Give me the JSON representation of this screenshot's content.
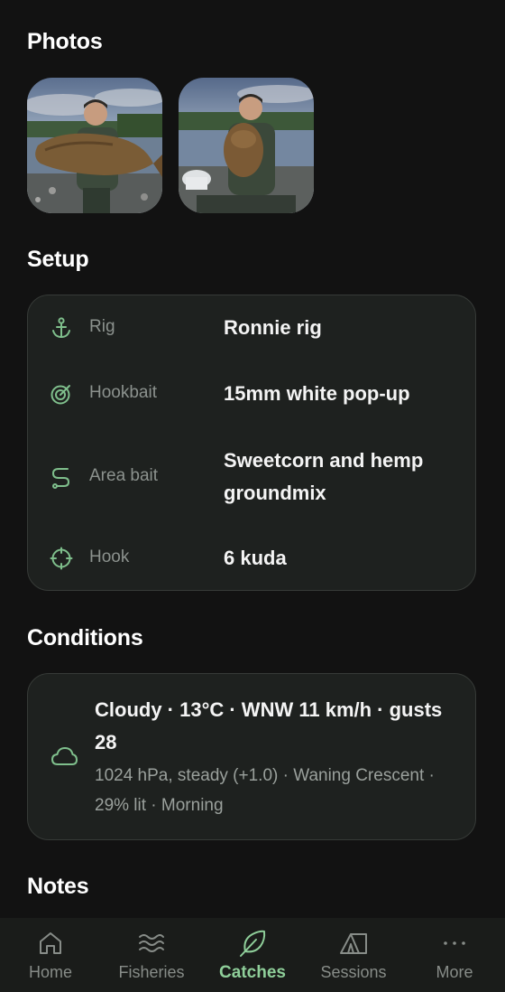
{
  "sections": {
    "photos": "Photos",
    "setup": "Setup",
    "conditions": "Conditions",
    "notes": "Notes"
  },
  "photos": [
    {
      "icon": "photo-angler-holding-carp"
    },
    {
      "icon": "photo-angler-holding-carp-front"
    }
  ],
  "setup": {
    "rows": [
      {
        "icon": "anchor-icon",
        "label": "Rig",
        "value": "Ronnie rig"
      },
      {
        "icon": "target-icon",
        "label": "Hookbait",
        "value": "15mm white pop-up"
      },
      {
        "icon": "route-icon",
        "label": "Area bait",
        "value": "Sweetcorn and hemp groundmix"
      },
      {
        "icon": "crosshair-icon",
        "label": "Hook",
        "value": "6 kuda"
      }
    ]
  },
  "conditions": {
    "icon": "cloud-icon",
    "summary": "Cloudy · 13°C · WNW 11 km/h · gusts 28",
    "details": "1024 hPa, steady (+1.0) · Waning Crescent · 29% lit · Morning"
  },
  "nav": {
    "items": [
      {
        "icon": "home-icon",
        "label": "Home",
        "active": false
      },
      {
        "icon": "waves-icon",
        "label": "Fisheries",
        "active": false
      },
      {
        "icon": "leaf-icon",
        "label": "Catches",
        "active": true
      },
      {
        "icon": "tent-icon",
        "label": "Sessions",
        "active": false
      },
      {
        "icon": "more-icon",
        "label": "More",
        "active": false
      }
    ]
  },
  "colors": {
    "background": "#121212",
    "card": "#1e211f",
    "accent": "#8fcf9a",
    "icon_green": "#7fbf8c",
    "muted": "#8c928e"
  }
}
